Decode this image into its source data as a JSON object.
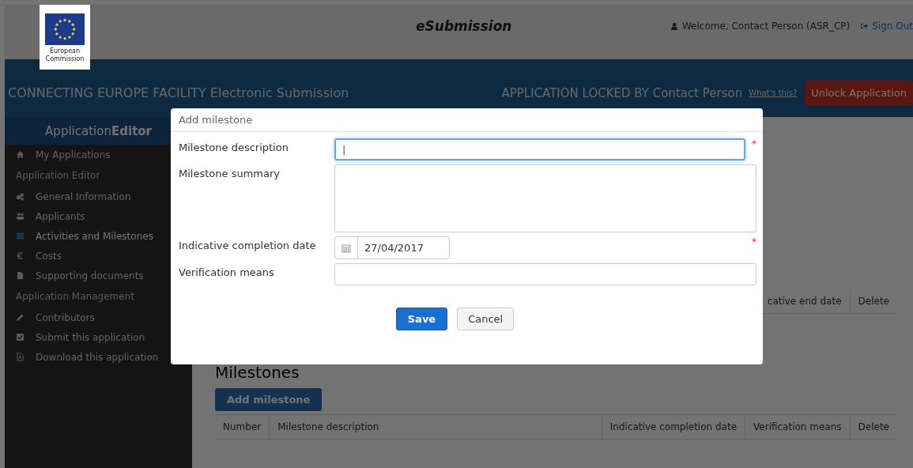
{
  "header": {
    "logo_caption": "European Commission",
    "app_name": "eSubmission",
    "welcome": "Welcome, Contact Person (ASR_CP)",
    "sign_out": "Sign Out"
  },
  "banner": {
    "title": "CONNECTING EUROPE FACILITY Electronic Submission",
    "lock_status": "APPLICATION LOCKED BY Contact Person",
    "help_link": "What's this?",
    "unlock_button": "Unlock Application"
  },
  "sidebar": {
    "title_plain": "Application",
    "title_bold": "Editor",
    "items": [
      {
        "kind": "link",
        "label": "My Applications",
        "selected": false
      },
      {
        "kind": "section",
        "label": "Application Editor"
      },
      {
        "kind": "link",
        "label": "General Information",
        "selected": false
      },
      {
        "kind": "link",
        "label": "Applicants",
        "selected": false
      },
      {
        "kind": "link",
        "label": "Activities and Milestones",
        "selected": true
      },
      {
        "kind": "link",
        "label": "Costs",
        "selected": false
      },
      {
        "kind": "link",
        "label": "Supporting documents",
        "selected": false
      },
      {
        "kind": "section",
        "label": "Application Management"
      },
      {
        "kind": "link",
        "label": "Contributors",
        "selected": false
      },
      {
        "kind": "link",
        "label": "Submit this application",
        "selected": false
      },
      {
        "kind": "link",
        "label": "Download this application",
        "selected": false
      }
    ]
  },
  "activities_table": {
    "columns": [
      "cative end date",
      "Delete"
    ]
  },
  "milestones": {
    "heading": "Milestones",
    "add_button": "Add milestone",
    "columns": [
      "Number",
      "Milestone description",
      "Indicative completion date",
      "Verification means",
      "Delete"
    ]
  },
  "dialog": {
    "title": "Add milestone",
    "fields": [
      {
        "kind": "text",
        "label": "Milestone description",
        "value": "|",
        "required": true,
        "focused": true
      },
      {
        "kind": "textarea",
        "label": "Milestone summary",
        "required": false,
        "focused": false
      },
      {
        "kind": "date",
        "label": "Indicative completion date",
        "value": "27/04/2017",
        "required": true,
        "focused": false
      },
      {
        "kind": "text",
        "label": "Verification means",
        "required": false,
        "focused": false
      }
    ],
    "required_mark": "*",
    "save_button": "Save",
    "cancel_button": "Cancel"
  }
}
